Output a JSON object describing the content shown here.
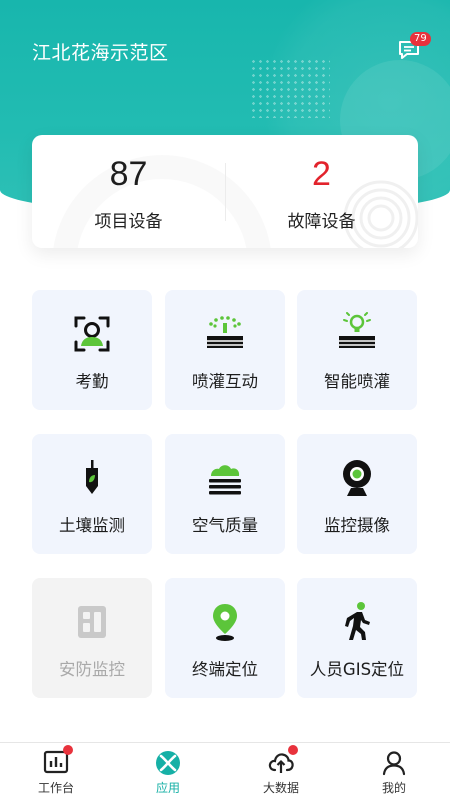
{
  "header": {
    "title": "江北花海示范区",
    "message_icon": "message-icon",
    "message_badge": "79"
  },
  "stats": {
    "project_devices": {
      "value": "87",
      "label": "项目设备"
    },
    "fault_devices": {
      "value": "2",
      "label": "故障设备"
    }
  },
  "apps": [
    {
      "label": "考勤",
      "icon": "face-scan-icon",
      "enabled": true
    },
    {
      "label": "喷灌互动",
      "icon": "sprinkler-icon",
      "enabled": true
    },
    {
      "label": "智能喷灌",
      "icon": "smart-irrigation-icon",
      "enabled": true
    },
    {
      "label": "土壤监测",
      "icon": "soil-sensor-icon",
      "enabled": true
    },
    {
      "label": "空气质量",
      "icon": "air-quality-icon",
      "enabled": true
    },
    {
      "label": "监控摄像",
      "icon": "webcam-icon",
      "enabled": true
    },
    {
      "label": "安防监控",
      "icon": "security-icon",
      "enabled": false
    },
    {
      "label": "终端定位",
      "icon": "location-pin-icon",
      "enabled": true
    },
    {
      "label": "人员GIS定位",
      "icon": "person-walking-icon",
      "enabled": true
    }
  ],
  "nav": [
    {
      "label": "工作台",
      "icon": "chart-icon",
      "badge": true,
      "active": false
    },
    {
      "label": "应用",
      "icon": "apps-icon",
      "badge": false,
      "active": true
    },
    {
      "label": "大数据",
      "icon": "cloud-upload-icon",
      "badge": true,
      "active": false
    },
    {
      "label": "我的",
      "icon": "user-icon",
      "badge": false,
      "active": false
    }
  ],
  "colors": {
    "brand_teal": "#1cb8ae",
    "accent_green": "#5cc53a",
    "alert_red": "#e2232c",
    "tile_bg": "#f1f5fd"
  }
}
